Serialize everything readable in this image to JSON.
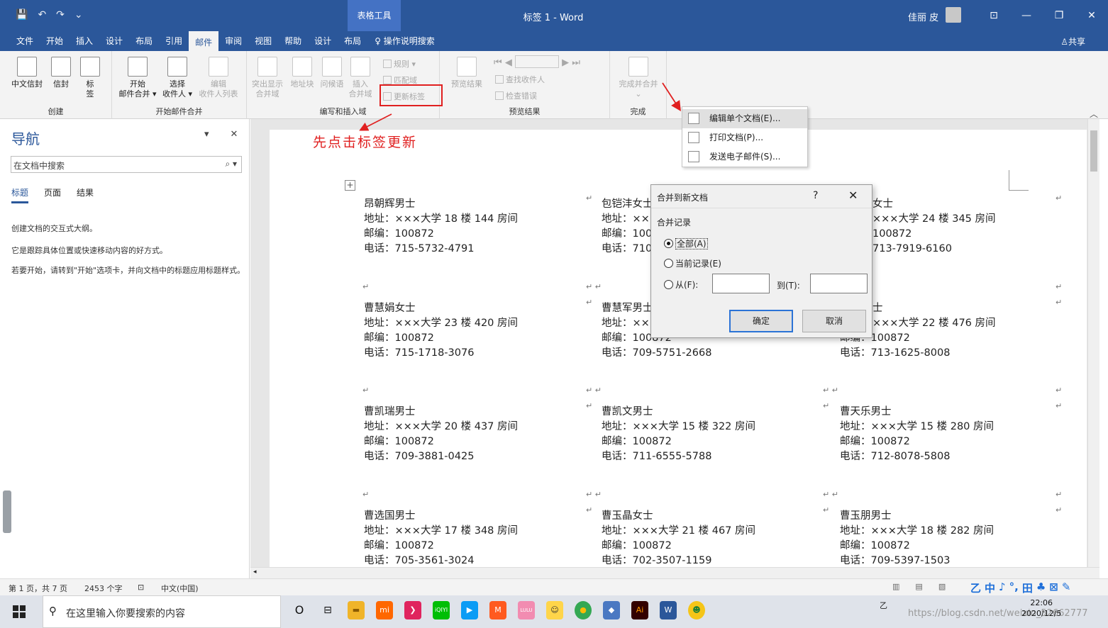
{
  "titlebar": {
    "qat": [
      "💾",
      "↶",
      "↷",
      "⌄"
    ],
    "context_tools": "表格工具",
    "doc_title": "标签 1  -  Word",
    "user": "佳丽 皮",
    "buttons": [
      "⊡",
      "—",
      "❐",
      "✕"
    ]
  },
  "tabs": {
    "items": [
      "文件",
      "开始",
      "插入",
      "设计",
      "布局",
      "引用",
      "邮件",
      "审阅",
      "视图",
      "帮助",
      "设计",
      "布局"
    ],
    "active_index": 6,
    "tellme": "操作说明搜索",
    "share": "共享"
  },
  "ribbon": {
    "groups": {
      "create": {
        "label": "创建",
        "buttons": [
          "中文信封",
          "信封",
          "标签"
        ]
      },
      "start": {
        "label": "开始邮件合并",
        "buttons": [
          "开始\n邮件合并 ▾",
          "选择\n收件人 ▾",
          "编辑\n收件人列表"
        ]
      },
      "write": {
        "label": "编写和插入域",
        "buttons": [
          "突出显示\n合并域",
          "地址块",
          "问候语",
          "插入\n合并域"
        ],
        "small": [
          "规则 ▾",
          "匹配域",
          "更新标签"
        ]
      },
      "preview": {
        "label": "预览结果",
        "button": "预览结果",
        "small": [
          "查找收件人",
          "检查错误"
        ]
      },
      "finish": {
        "label": "完成",
        "button": "完成并合并"
      }
    }
  },
  "menu": {
    "items": [
      "编辑单个文档(E)...",
      "打印文档(P)...",
      "发送电子邮件(S)..."
    ]
  },
  "annotation": "先点击标签更新",
  "nav": {
    "title": "导航",
    "search_placeholder": "在文档中搜索",
    "tabs": [
      "标题",
      "页面",
      "结果"
    ],
    "p1": "创建文档的交互式大纲。",
    "p2": "它是跟踪具体位置或快速移动内容的好方式。",
    "p3": "若要开始，请转到\"开始\"选项卡，并向文档中的标题应用标题样式。"
  },
  "dialog": {
    "title": "合并到新文档",
    "help": "?",
    "close": "✕",
    "section": "合并记录",
    "all": "全部(A)",
    "current": "当前记录(E)",
    "from": "从(F):",
    "to": "到(T):",
    "ok": "确定",
    "cancel": "取消"
  },
  "labels": [
    {
      "name": "昂朝辉男士",
      "addr": "地址：×××大学 18 楼 144 房间",
      "zip": "邮编：100872",
      "tel": "电话：715-5732-4791"
    },
    {
      "name": "包铠沣女士",
      "addr": "地址：××",
      "zip": "邮编：100",
      "tel": "电话：710"
    },
    {
      "name": "女士",
      "addr": "×××大学 24 楼 345 房间",
      "zip": "100872",
      "tel": "713-7919-6160"
    },
    {
      "name": "曹慧娟女士",
      "addr": "地址：×××大学 23 楼 420 房间",
      "zip": "邮编：100872",
      "tel": "电话：715-1718-3076"
    },
    {
      "name": "曹慧军男士",
      "addr": "地址：××",
      "zip": "邮编：100872",
      "tel": "电话：709-5751-2668"
    },
    {
      "name": "士",
      "addr": "×××大学 22 楼 476 房间",
      "zip": "邮编：100872",
      "tel": "电话：713-1625-8008"
    },
    {
      "name": "曹凯瑞男士",
      "addr": "地址：×××大学 20 楼 437 房间",
      "zip": "邮编：100872",
      "tel": "电话：709-3881-0425"
    },
    {
      "name": "曹凯文男士",
      "addr": "地址：×××大学 15 楼 322 房间",
      "zip": "邮编：100872",
      "tel": "电话：711-6555-5788"
    },
    {
      "name": "曹天乐男士",
      "addr": "地址：×××大学 15 楼 280 房间",
      "zip": "邮编：100872",
      "tel": "电话：712-8078-5808"
    },
    {
      "name": "曹选国男士",
      "addr": "地址：×××大学 17 楼 348 房间",
      "zip": "邮编：100872",
      "tel": "电话：705-3561-3024"
    },
    {
      "name": "曹玉晶女士",
      "addr": "地址：×××大学 21 楼 467 房间",
      "zip": "邮编：100872",
      "tel": "电话：702-3507-1159"
    },
    {
      "name": "曹玉朋男士",
      "addr": "地址：×××大学 18 楼 282 房间",
      "zip": "邮编：100872",
      "tel": "电话：709-5397-1503"
    }
  ],
  "status": {
    "page": "第 1 页，共 7 页",
    "words": "2453 个字",
    "lang": "中文(中国)",
    "ime": [
      "乙",
      "中",
      "♪",
      "°,",
      "田",
      "♣",
      "⊠",
      "✎"
    ]
  },
  "taskbar": {
    "search": "在这里输入你要搜索的内容",
    "apps": [
      "O",
      "⊟",
      "▬",
      "mi",
      "❯",
      "iQIYI",
      "▶",
      "M",
      "LULU",
      "☺",
      "●",
      "◆",
      "Ai",
      "W",
      "☻"
    ],
    "time": "22:06",
    "date": "2020/12/5",
    "watermark": "https://blog.csdn.net/weixin_52662777"
  }
}
